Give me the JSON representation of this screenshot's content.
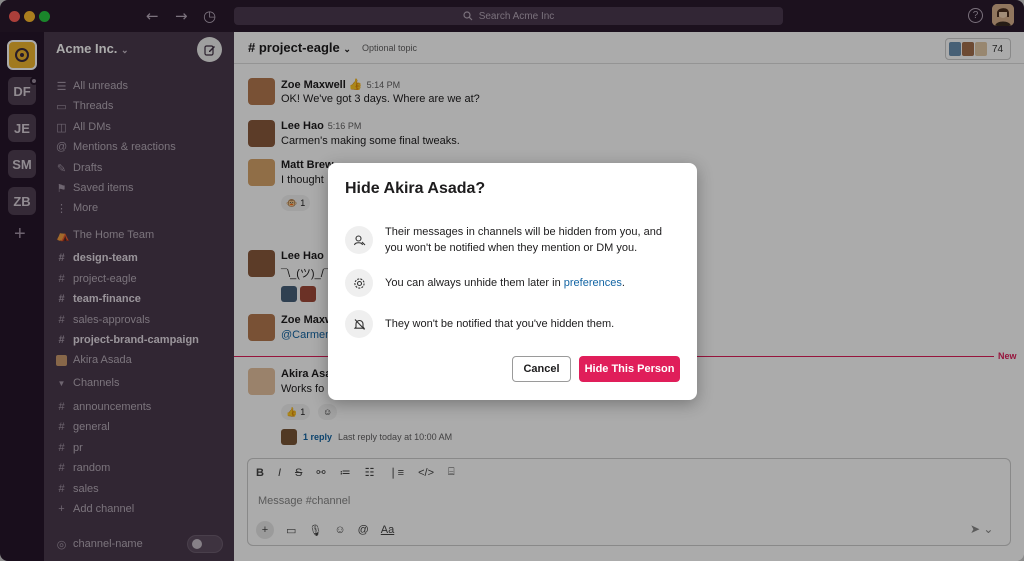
{
  "search_placeholder": "Search Acme Inc",
  "workspaces": [
    "DF",
    "JE",
    "SM",
    "ZB"
  ],
  "team_name": "Acme Inc.",
  "nav": [
    {
      "icon": "all-unreads-icon",
      "label": "All unreads"
    },
    {
      "icon": "threads-icon",
      "label": "Threads"
    },
    {
      "icon": "all-dms-icon",
      "label": "All DMs"
    },
    {
      "icon": "mentions-icon",
      "label": "Mentions & reactions"
    },
    {
      "icon": "drafts-icon",
      "label": "Drafts"
    },
    {
      "icon": "saved-items-icon",
      "label": "Saved items"
    },
    {
      "icon": "more-icon",
      "label": "More"
    }
  ],
  "section_home_team": "The Home Team",
  "home_channels": [
    {
      "label": "design-team",
      "bold": true
    },
    {
      "label": "project-eagle",
      "bold": false
    },
    {
      "label": "team-finance",
      "bold": true
    },
    {
      "label": "sales-approvals",
      "bold": false
    },
    {
      "label": "project-brand-campaign",
      "bold": true
    }
  ],
  "dm_akira": "Akira Asada",
  "section_channels": "Channels",
  "channels": [
    "announcements",
    "general",
    "pr",
    "random",
    "sales"
  ],
  "add_channel": "Add channel",
  "bottom_channel": "channel-name",
  "channel": {
    "name": "# project-eagle",
    "topic": "Optional topic",
    "member_count": "74"
  },
  "messages": [
    {
      "name": "Zoe Maxwell",
      "emoji": "👍",
      "time": "5:14 PM",
      "text": "OK! We've got 3 days. Where are we at?"
    },
    {
      "name": "Lee Hao",
      "time": "5:16 PM",
      "text": "Carmen's making some final tweaks."
    },
    {
      "name": "Matt Brew",
      "text": "I thought"
    },
    {
      "name": "Lee Hao",
      "text": "¯\\_(ツ)_/¯"
    },
    {
      "name": "Zoe Maxw",
      "text": "@Carmen"
    },
    {
      "name": "Akira Asada",
      "text": "Works fo"
    }
  ],
  "reactions": {
    "r1": "1",
    "r2": "1"
  },
  "new_label": "New",
  "thread": {
    "replies": "1 reply",
    "last": "Last reply today at 10:00 AM"
  },
  "composer_placeholder": "Message #channel",
  "modal": {
    "title": "Hide Akira Asada?",
    "row1": "Their messages in channels will be hidden from you, and you won't be notified when they mention or DM you.",
    "row2_prefix": "You can always unhide them later in ",
    "row2_link": "preferences",
    "row2_suffix": ".",
    "row3": "They won't be notified that you've hidden them.",
    "cancel": "Cancel",
    "confirm": "Hide This Person"
  },
  "colors": {
    "accent": "#e01e5a",
    "sidebar": "#4a3a4d",
    "link": "#1264a3"
  }
}
